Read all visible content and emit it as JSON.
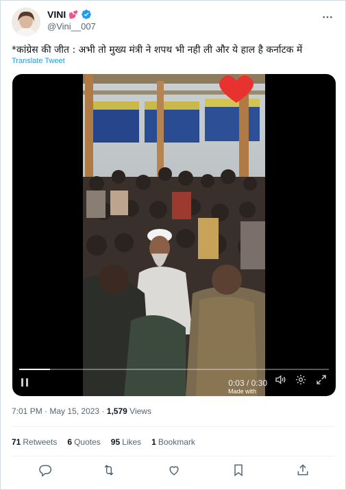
{
  "author": {
    "name": "VINI",
    "name_emoji": "💕",
    "handle": "@Vini__007",
    "verified": true
  },
  "tweet": {
    "text": "*कांग्रेस की जीत : अभी तो मुख्य मंत्री ने शपथ भी नही ली और ये हाल है कर्नाटक में",
    "translate_label": "Translate Tweet"
  },
  "video": {
    "time_label": "0:03 / 0:30",
    "progress": 0.1
  },
  "meta": {
    "time": "7:01 PM",
    "date": "May 15, 2023",
    "views_count": "1,579",
    "views_label": "Views"
  },
  "stats": {
    "retweets_count": "71",
    "retweets_label": "Retweets",
    "quotes_count": "6",
    "quotes_label": "Quotes",
    "likes_count": "95",
    "likes_label": "Likes",
    "bookmarks_count": "1",
    "bookmarks_label": "Bookmark"
  },
  "icons": {
    "verified": "verified-badge-icon",
    "more": "more-icon",
    "reply": "reply-icon",
    "retweet": "retweet-icon",
    "like": "like-icon",
    "bookmark": "bookmark-icon",
    "share": "share-icon"
  },
  "colors": {
    "accent": "#1d9bf0",
    "secondary_text": "#536471",
    "primary_text": "#0f1419"
  }
}
